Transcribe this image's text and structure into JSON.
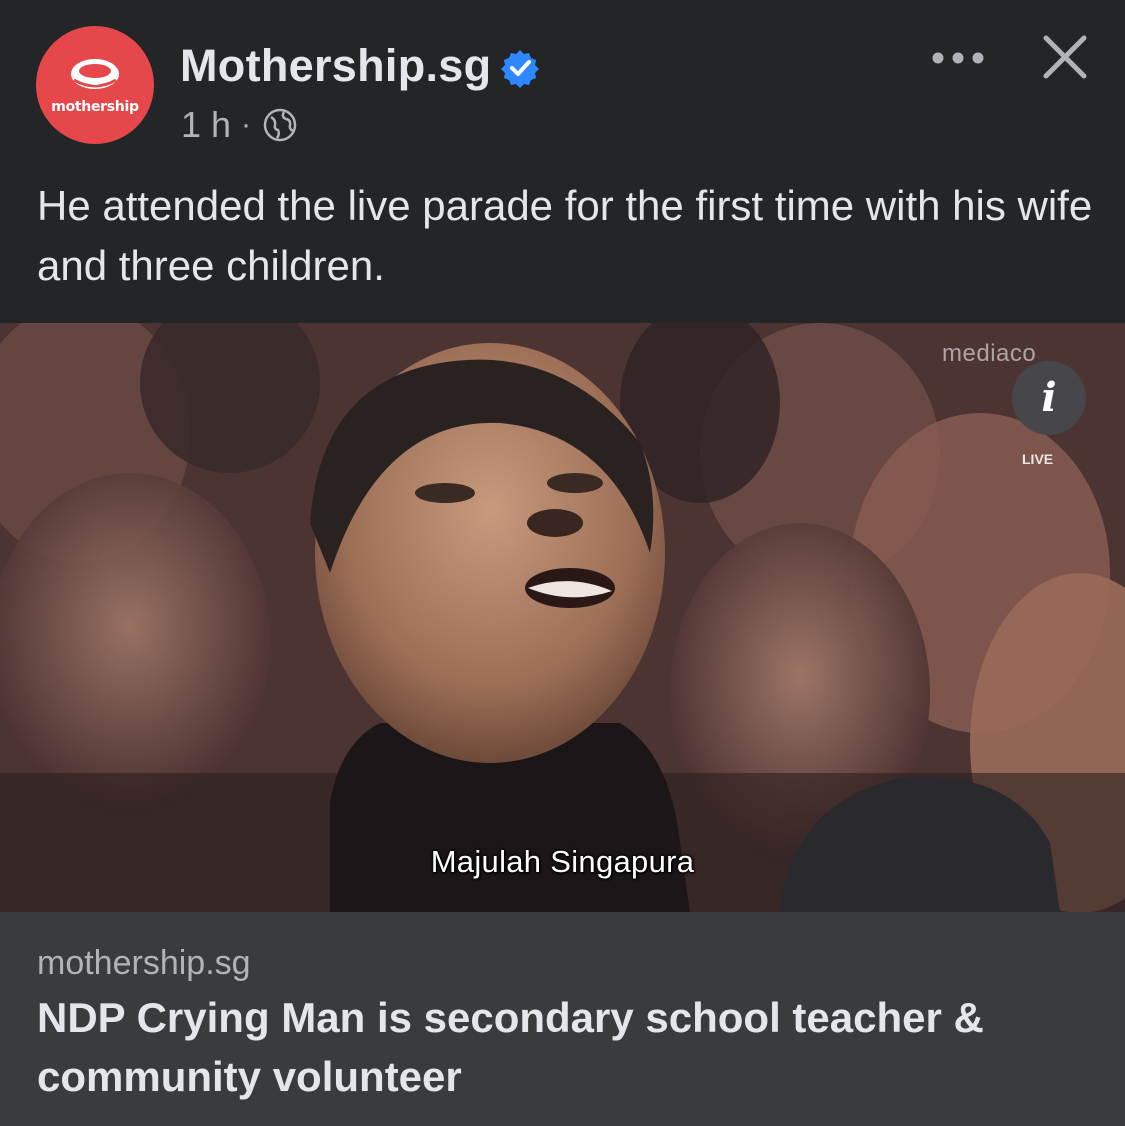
{
  "post": {
    "page_name": "Mothership.sg",
    "time": "1 h",
    "separator": "·",
    "avatar_label": "mothership",
    "caption": "He attended the live parade for the first time with his wife and three children.",
    "icons": {
      "verified": "verified-badge-icon",
      "audience": "globe-icon",
      "more": "more-options-icon",
      "close": "close-icon"
    }
  },
  "photo": {
    "subtitle": "Majulah Singapura",
    "watermark": "mediaco",
    "info": "i",
    "live": "LIVE"
  },
  "link_preview": {
    "domain": "mothership.sg",
    "title": "NDP Crying Man is secondary school teacher & community volunteer"
  },
  "colors": {
    "background": "#242526",
    "link_card": "#3a3b3c",
    "brand_red": "#e5474b",
    "verified_blue": "#2d88ff",
    "primary_text": "#e4e6eb",
    "secondary_text": "#b0b3b8"
  }
}
